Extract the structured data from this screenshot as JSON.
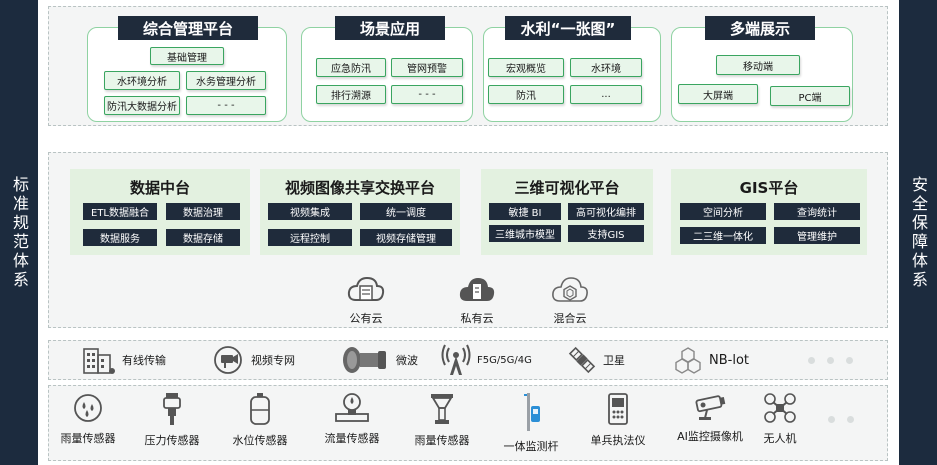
{
  "left_bar": "标准规范体系",
  "right_bar": "安全保障体系",
  "top_groups": [
    {
      "title": "综合管理平台",
      "items": [
        "基础管理",
        "水环境分析",
        "水务管理分析",
        "防汛大数据分析",
        "- - -"
      ]
    },
    {
      "title": "场景应用",
      "items": [
        "应急防汛",
        "管网预警",
        "排行溯源",
        "- - -"
      ]
    },
    {
      "title": "水利“一张图”",
      "items": [
        "宏观概览",
        "水环境",
        "防汛",
        "..."
      ]
    },
    {
      "title": "多端展示",
      "items": [
        "移动端",
        "大屏端",
        "PC端"
      ]
    }
  ],
  "platforms": [
    {
      "title": "数据中台",
      "items": [
        "ETL数据融合",
        "数据治理",
        "数据服务",
        "数据存储"
      ]
    },
    {
      "title": "视频图像共享交换平台",
      "items": [
        "视频集成",
        "统一调度",
        "远程控制",
        "视频存储管理"
      ]
    },
    {
      "title": "三维可视化平台",
      "items": [
        "敏捷 BI",
        "高可视化编排",
        "三维城市模型",
        "支持GIS"
      ]
    },
    {
      "title": "GIS平台",
      "items": [
        "空间分析",
        "查询统计",
        "二三维一体化",
        "管理维护"
      ]
    }
  ],
  "clouds": [
    "公有云",
    "私有云",
    "混合云"
  ],
  "network": [
    "有线传输",
    "视频专网",
    "微波",
    "F5G/5G/4G",
    "卫星",
    "NB-lot"
  ],
  "devices": [
    "雨量传感器",
    "压力传感器",
    "水位传感器",
    "流量传感器",
    "雨量传感器",
    "一体监测杆",
    "单兵执法仪",
    "AI监控摄像机",
    "无人机"
  ],
  "colors": {
    "navy": "#1f2b3b",
    "green_border": "#3aa560",
    "green_fill": "#e8f6ea",
    "platform_fill": "#e3f1e0"
  }
}
